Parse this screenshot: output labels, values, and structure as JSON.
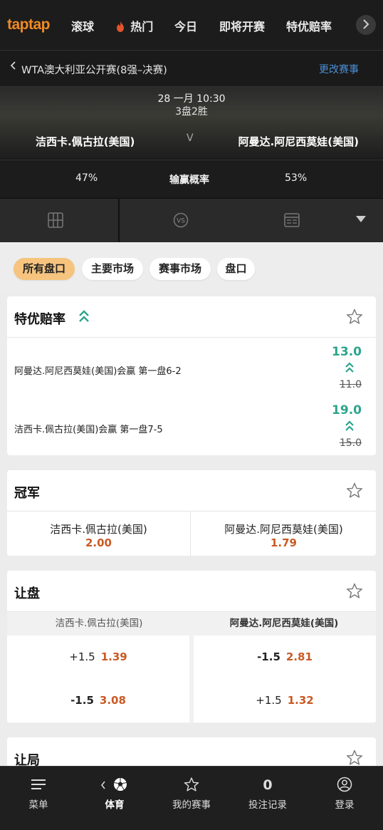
{
  "topnav": {
    "logo": "taptap",
    "items": [
      "滚球",
      "热门",
      "今日",
      "即将开赛",
      "特优赔率"
    ],
    "hot_icon": "flame-icon",
    "more_icon": "chevron-right-icon"
  },
  "event": {
    "title": "WTA澳大利亚公开赛(8强–决赛)",
    "change_label": "更改赛事",
    "datetime": "28 一月 10:30",
    "format": "3盘2胜",
    "player_home": "洁西卡.佩古拉(美国)",
    "player_away": "阿曼达.阿尼西莫娃(美国)",
    "vs": "V",
    "prob_home": "47%",
    "prob_label": "输赢概率",
    "prob_away": "53%",
    "tabs": [
      "stats-grid-icon",
      "vs-icon",
      "scoreboard-icon",
      "caret-down-icon"
    ]
  },
  "filters": {
    "chips": [
      "所有盘口",
      "主要市场",
      "赛事市场",
      "盘口"
    ],
    "active": "所有盘口"
  },
  "boosted": {
    "title": "特优赔率",
    "rows": [
      {
        "label": "阿曼达.阿尼西莫娃(美国)会赢 第一盘6-2",
        "new_odd": "13.0",
        "old_odd": "11.0"
      },
      {
        "label": "洁西卡.佩古拉(美国)会赢 第一盘7-5",
        "new_odd": "19.0",
        "old_odd": "15.0"
      }
    ]
  },
  "winner": {
    "title": "冠军",
    "home_name": "洁西卡.佩古拉(美国)",
    "home_odd": "2.00",
    "away_name": "阿曼达.阿尼西莫娃(美国)",
    "away_odd": "1.79"
  },
  "handicap": {
    "title": "让盘",
    "home_header": "洁西卡.佩古拉(美国)",
    "away_header": "阿曼达.阿尼西莫娃(美国)",
    "home": [
      {
        "line": "+1.5",
        "odd": "1.39"
      },
      {
        "line": "-1.5",
        "odd": "3.08"
      }
    ],
    "away": [
      {
        "line": "-1.5",
        "odd": "2.81"
      },
      {
        "line": "+1.5",
        "odd": "1.32"
      }
    ]
  },
  "games_handicap": {
    "title": "让局"
  },
  "bottomnav": {
    "items": [
      {
        "label": "菜单",
        "icon": "menu-icon"
      },
      {
        "label": "体育",
        "icon": "soccer-ball-icon"
      },
      {
        "label": "我的赛事",
        "icon": "star-icon"
      },
      {
        "label": "投注记录",
        "icon": "bet-count",
        "count": "0"
      },
      {
        "label": "登录",
        "icon": "user-icon"
      }
    ]
  },
  "colors": {
    "brand": "#f08a24",
    "accent_green": "#2ca58d",
    "odd_orange": "#c85a24",
    "link_blue": "#4a8fd6",
    "chip_active": "#f6c47e"
  }
}
